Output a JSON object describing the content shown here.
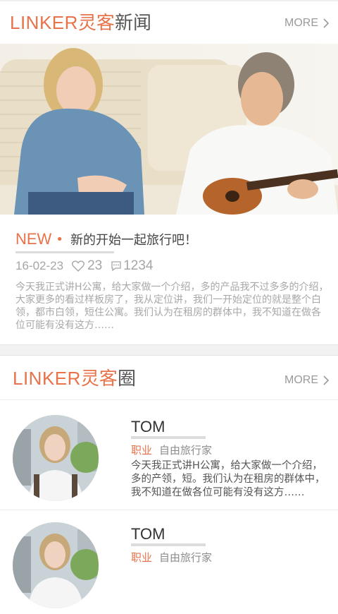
{
  "news_section": {
    "brand_latin": "LINKER",
    "brand_cn": "灵客",
    "brand_suffix": "新闻",
    "more_label": "MORE",
    "hero_icon": "photo-couple-guitar",
    "tag": "NEW",
    "title": "新的开始一起旅行吧！",
    "date": "16-02-23",
    "likes": "23",
    "comments": "1234",
    "excerpt": "今天我正式讲H公寓，给大家做一个介绍，多的产品我不过多多的介绍，大家更多的看过样板房了，我从定位讲，我们一开始定位的就是整个白领，都市白领，短住公寓。我们认为在租房的群体中，我不知道在做各位可能有没有这方……"
  },
  "circle_section": {
    "brand_latin": "LINKER",
    "brand_cn": "灵客",
    "brand_suffix": "圈",
    "more_label": "MORE",
    "people": [
      {
        "name": "TOM",
        "role_key": "职业",
        "role_value": "自由旅行家",
        "desc": "今天我正式讲H公寓，给大家做一个介绍，多的产领，短。我们认为在租房的群体中，我不知道在做各位可能有没有这方……"
      },
      {
        "name": "TOM",
        "role_key": "职业",
        "role_value": "自由旅行家",
        "desc": ""
      }
    ]
  },
  "colors": {
    "accent": "#e8734a",
    "muted_text": "#a8a8a8",
    "divider": "#ececec"
  }
}
